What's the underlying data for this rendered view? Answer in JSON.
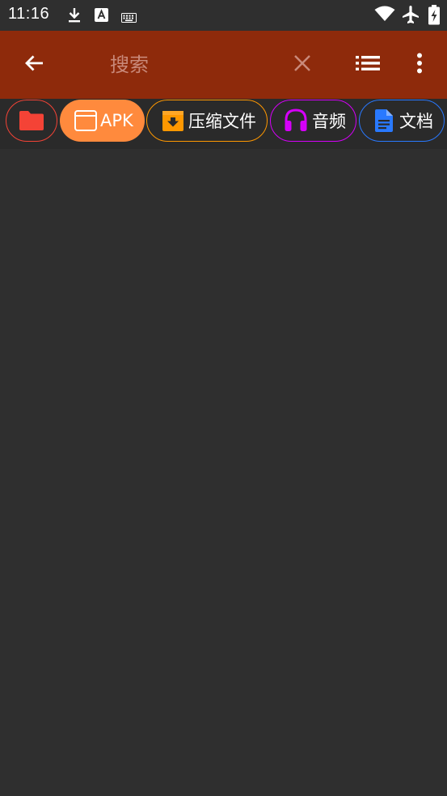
{
  "status_bar": {
    "time": "11:16",
    "icons": [
      "download-icon",
      "a-app-icon",
      "keyboard-icon",
      "wifi-icon",
      "airplane-icon",
      "battery-charging-icon"
    ]
  },
  "toolbar": {
    "background": "#8e2a0b",
    "back_icon": "arrow-left-icon",
    "search_placeholder": "搜索",
    "search_value": "",
    "clear_icon": "close-icon",
    "view_icon": "list-view-icon",
    "more_icon": "more-vert-icon"
  },
  "filters": [
    {
      "id": "folder",
      "label": "",
      "icon": "folder-icon",
      "color": "#f44336",
      "selected": false
    },
    {
      "id": "apk",
      "label": "APK",
      "icon": "window-icon",
      "color": "#ff8a3d",
      "selected": true
    },
    {
      "id": "archive",
      "label": "压缩文件",
      "icon": "archive-icon",
      "color": "#ff9800",
      "selected": false
    },
    {
      "id": "audio",
      "label": "音频",
      "icon": "headphones-icon",
      "color": "#d500f9",
      "selected": false
    },
    {
      "id": "document",
      "label": "文档",
      "icon": "document-icon",
      "color": "#2979ff",
      "selected": false
    }
  ]
}
